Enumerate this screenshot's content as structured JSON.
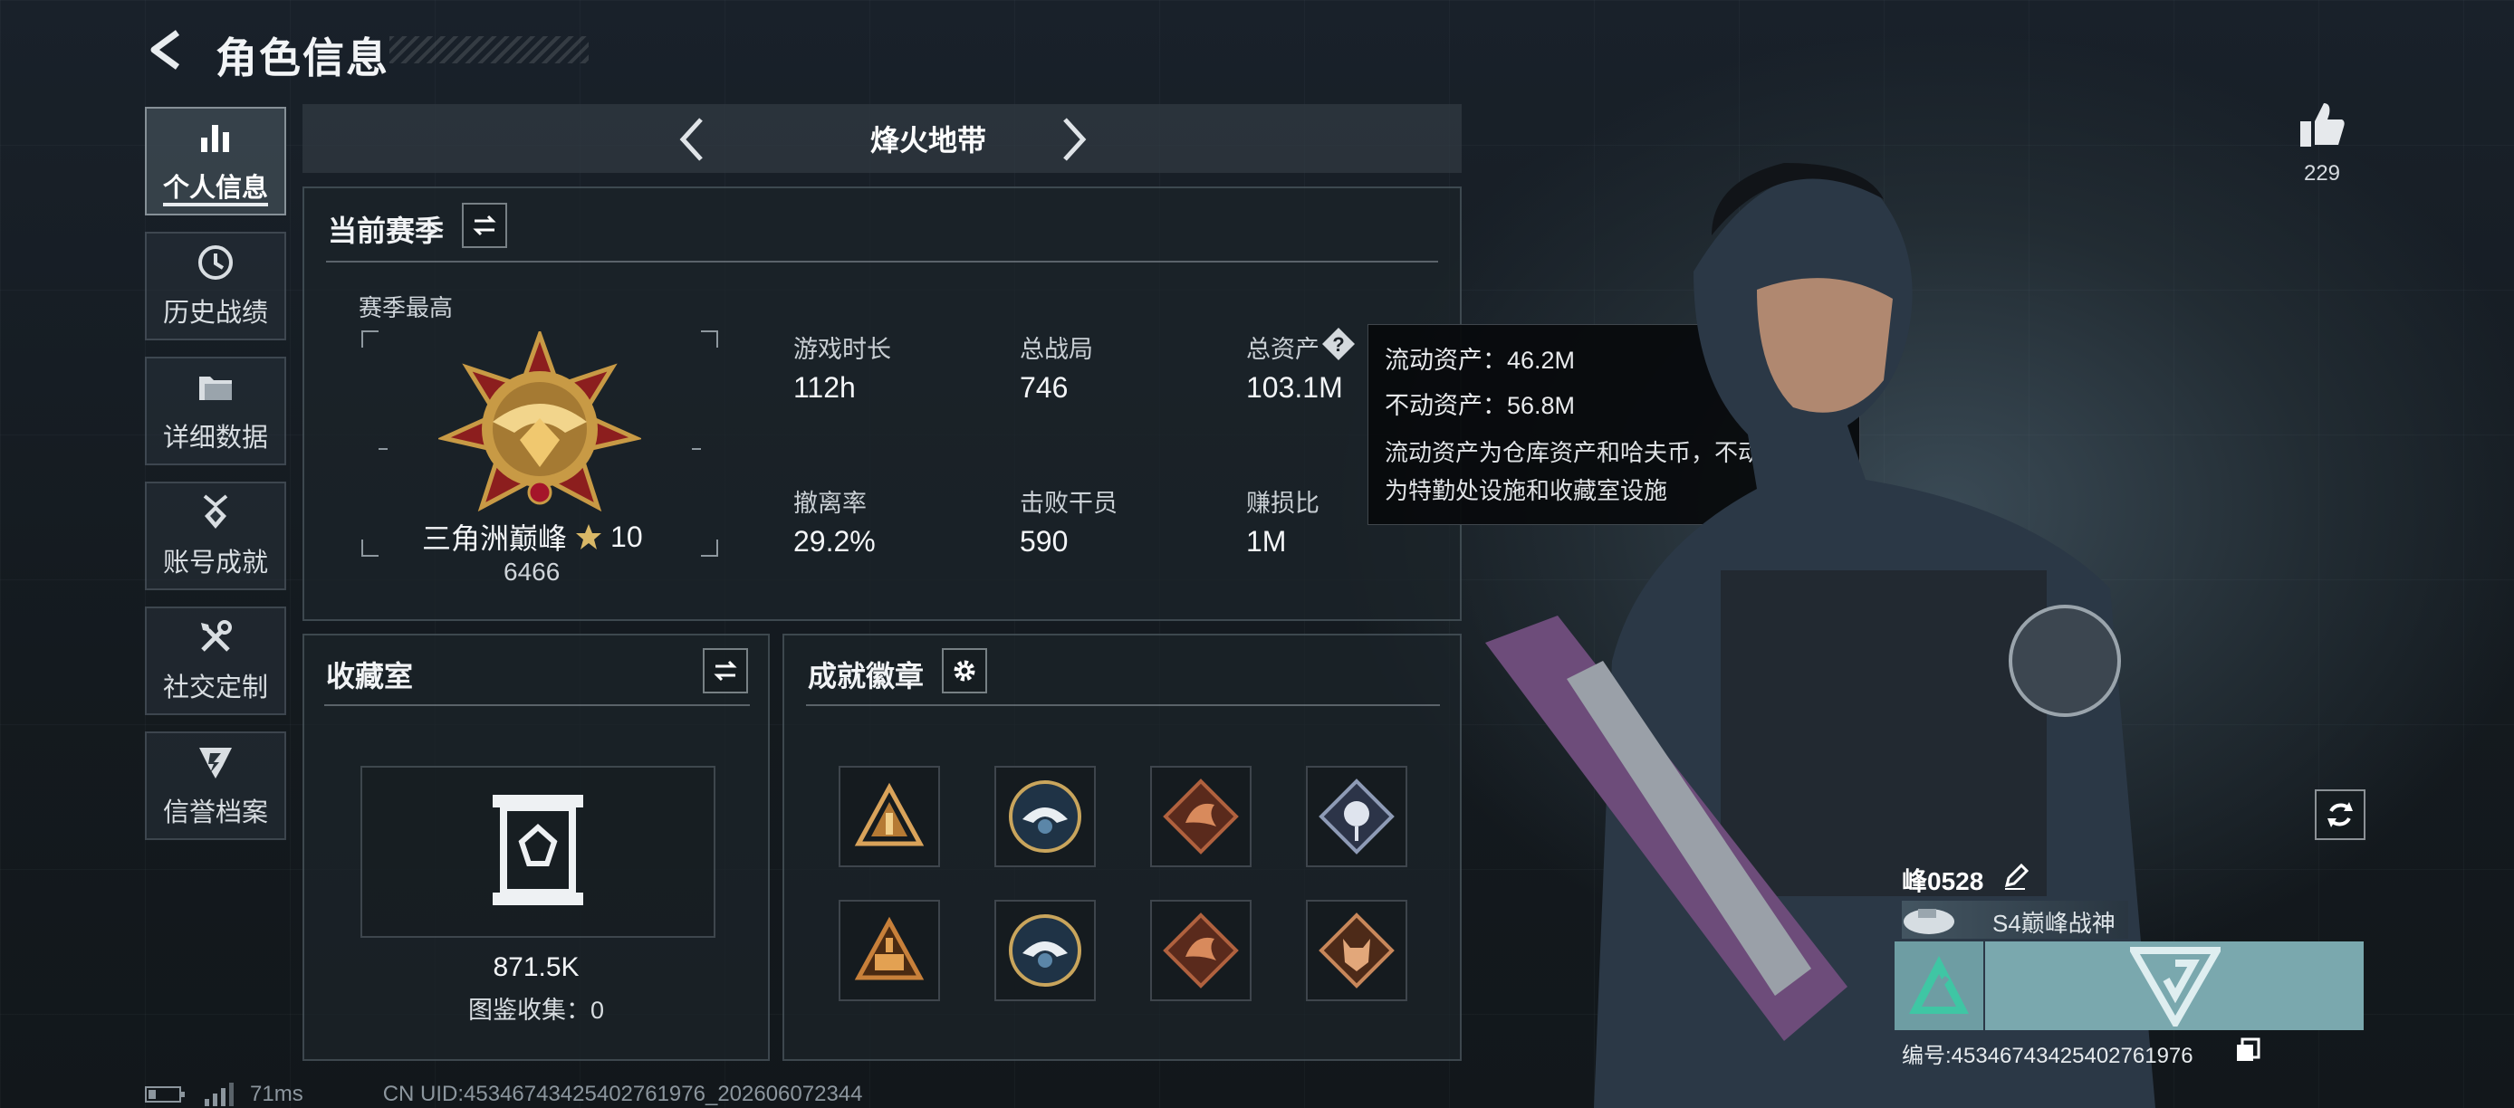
{
  "header": {
    "title": "角色信息"
  },
  "sidebar": {
    "items": [
      {
        "label": "个人信息",
        "icon": "bar-chart-icon",
        "active": true
      },
      {
        "label": "历史战绩",
        "icon": "clock-icon",
        "active": false
      },
      {
        "label": "详细数据",
        "icon": "folder-icon",
        "active": false
      },
      {
        "label": "账号成就",
        "icon": "medal-icon",
        "active": false
      },
      {
        "label": "社交定制",
        "icon": "tools-icon",
        "active": false
      },
      {
        "label": "信誉档案",
        "icon": "shield-icon",
        "active": false
      }
    ]
  },
  "mode": {
    "label": "烽火地带"
  },
  "season": {
    "title": "当前赛季",
    "best_label": "赛季最高",
    "rank_name": "三角洲巅峰",
    "rank_level": "10",
    "rank_score": "6466",
    "stats": [
      {
        "label": "游戏时长",
        "value": "112h"
      },
      {
        "label": "总战局",
        "value": "746"
      },
      {
        "label": "总资产",
        "value": "103.1M"
      },
      {
        "label": "撤离率",
        "value": "29.2%"
      },
      {
        "label": "击败干员",
        "value": "590"
      },
      {
        "label": "赚损比",
        "value": "1M"
      }
    ]
  },
  "tooltip": {
    "liquid": "流动资产：46.2M",
    "fixed": "不动资产：56.8M",
    "desc_1": "流动资产为仓库资产和哈夫币，不动资产",
    "desc_2": "为特勤处设施和收藏室设施"
  },
  "collection": {
    "title": "收藏室",
    "value": "871.5K",
    "count_label": "图鉴收集：0"
  },
  "achievements": {
    "title": "成就徽章",
    "badges": [
      {
        "icon": "triangle-badge-icon",
        "color": "#d9a35a"
      },
      {
        "icon": "eagle-badge-icon",
        "color": "#5b86a8"
      },
      {
        "icon": "dragon-badge-icon",
        "color": "#b0613e"
      },
      {
        "icon": "rose-badge-icon",
        "color": "#8e9bb6"
      },
      {
        "icon": "triangle-badge-icon",
        "color": "#c8803a"
      },
      {
        "icon": "eagle-badge-icon",
        "color": "#5b86a8"
      },
      {
        "icon": "dragon-badge-icon",
        "color": "#b0613e"
      },
      {
        "icon": "wolf-badge-icon",
        "color": "#c8875a"
      }
    ]
  },
  "likes": {
    "count": "229"
  },
  "player": {
    "name": "峰0528",
    "title": "S4巅峰战神",
    "uid": "编号:45346743425402761976"
  },
  "status": {
    "ping": "71ms",
    "uid": "CN UID:45346743425402761976_202606072344"
  },
  "colors": {
    "accent_teal": "#7aa8ae",
    "rank_gold": "#c89a45"
  }
}
